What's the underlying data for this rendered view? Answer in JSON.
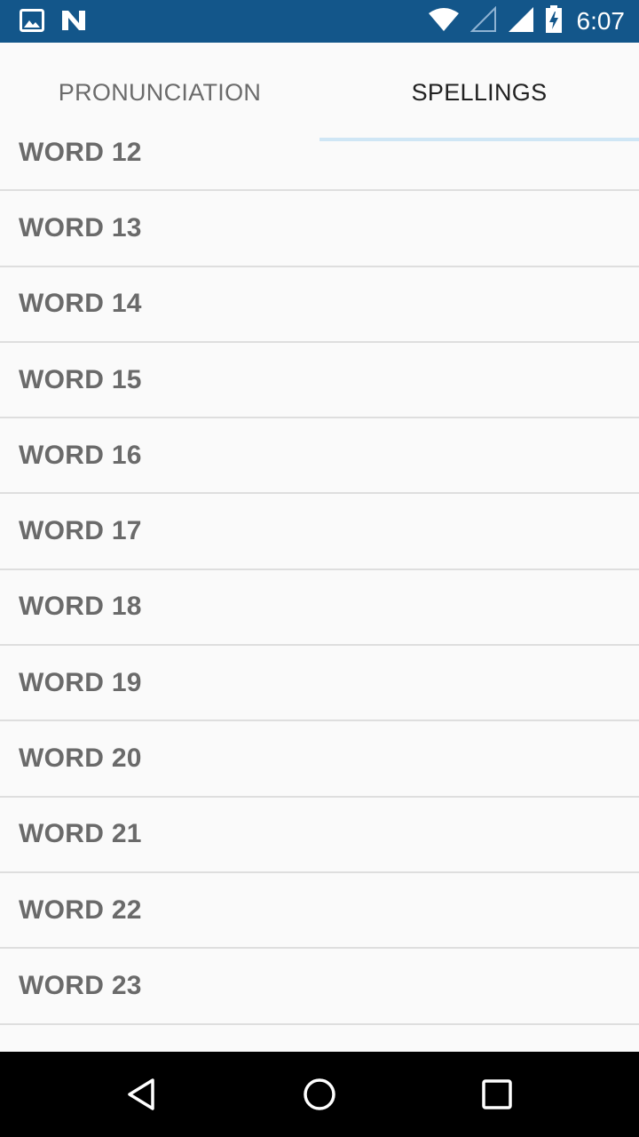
{
  "status_bar": {
    "time": "6:07",
    "left_icons": [
      "image-notification-icon",
      "n-notification-icon"
    ],
    "right_icons": [
      "wifi-icon",
      "signal-empty-icon",
      "signal-full-icon",
      "battery-charging-icon"
    ]
  },
  "tabs": [
    {
      "label": "PRONUNCIATION",
      "selected": false
    },
    {
      "label": "SPELLINGS",
      "selected": true
    }
  ],
  "list": {
    "items": [
      "WORD 12",
      "WORD 13",
      "WORD 14",
      "WORD 15",
      "WORD 16",
      "WORD 17",
      "WORD 18",
      "WORD 19",
      "WORD 20",
      "WORD 21",
      "WORD 22",
      "WORD 23",
      ""
    ]
  },
  "nav_bar": {
    "buttons": [
      "back-icon",
      "home-icon",
      "recents-icon"
    ]
  },
  "colors": {
    "status_bar": "#13568a",
    "tab_indicator": "#cfe6f5",
    "background": "#fafafa"
  }
}
